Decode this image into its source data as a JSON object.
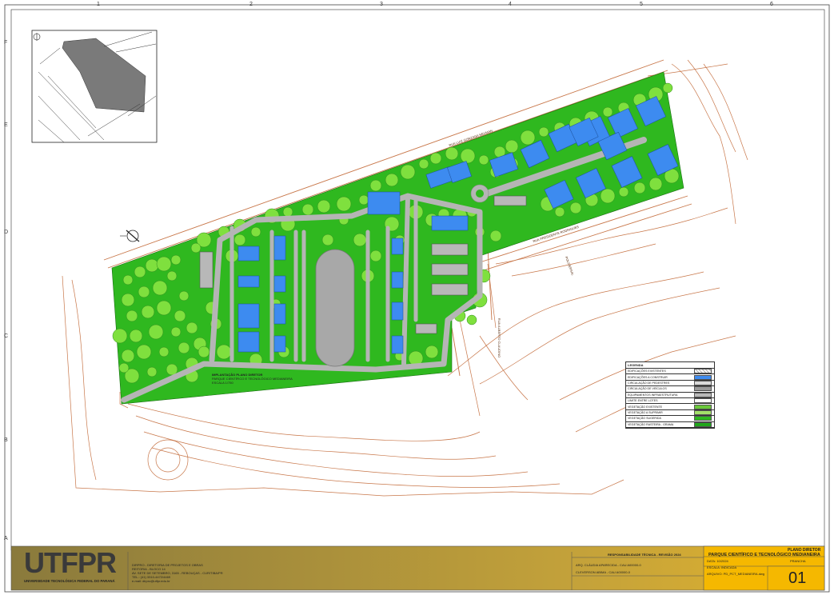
{
  "grid": {
    "columns": [
      "1",
      "2",
      "3",
      "4",
      "5",
      "6"
    ],
    "rows": [
      "F",
      "E",
      "D",
      "C",
      "B",
      "A"
    ]
  },
  "title_block": {
    "logo": "UTFPR",
    "logo_caption": "UNIVERSIDADE TECNOLÓGICA FEDERAL DO PARANÁ",
    "office_lines": [
      "DIRPRO - DIRETORIA DE PROJETOS E OBRAS",
      "REITORIA - BLOCO 14",
      "AV. SETE DE SETEMBRO, 3165 - REBOUÇAS - CURITIBA/PR",
      "TEL.: (41) 3310-4472/4469",
      "e-mail: dirpro@utfpr.edu.br"
    ],
    "responsibility": "RESPONSABILIDADE TÉCNICA - REVISÃO 2024",
    "resp_lines": [
      "ARQ. CLÁUDIA APARECIDA - CAU A00000-0",
      "CLEVERSON ABIMA - CAU A00000-0"
    ],
    "plan_title": "PLANO DIRETOR",
    "project_name": "PARQUE CIENTÍFICO E TECNOLÓGICO MEDIANEIRA",
    "fields": [
      {
        "label": "DATA:",
        "value": "10/2024"
      },
      {
        "label": "ESCALA:",
        "value": "INDICADA"
      },
      {
        "label": "ARQUIVO:",
        "value": "PD_PCT_MEDIANEIRA.dwg"
      }
    ],
    "sheet_label": "PRANCHA",
    "sheet_number": "01"
  },
  "plan_caption": [
    "IMPLANTAÇÃO PLANO DIRETOR",
    "PARQUE CIENTÍFICO E TECNOLÓGICO MEDIANEIRA",
    "ESCALA 1/750"
  ],
  "legend": {
    "title": "LEGENDA",
    "items": [
      {
        "label": "EDIFICAÇÕES EXISTENTES",
        "swatch": "#ffffff",
        "pattern": "hatch"
      },
      {
        "label": "EDIFICAÇÕES A CONSTRUIR",
        "swatch": "#3d8bf0",
        "pattern": "solid"
      },
      {
        "label": "CIRCULAÇÃO DE PEDESTRES",
        "swatch": "#d9d9d9",
        "pattern": "solid"
      },
      {
        "label": "CIRCULAÇÃO DE VEÍCULOS",
        "swatch": "#9a9a9a",
        "pattern": "dots"
      },
      {
        "label": "EQUIPAMENTOS INFRAESTRUTURA",
        "swatch": "#b8b8b8",
        "pattern": "solid"
      },
      {
        "label": "LIMITE ENTRE LOTES",
        "swatch": "#ffffff",
        "pattern": "line"
      },
      {
        "label": "VEGETAÇÃO EXISTENTE",
        "swatch": "#6ac93a",
        "pattern": "tree"
      },
      {
        "label": "VEGETAÇÃO A SUPRIMIR",
        "swatch": "#a3e06a",
        "pattern": "tree"
      },
      {
        "label": "VEGETAÇÃO SUGERIDA",
        "swatch": "#2fb81f",
        "pattern": "tree"
      },
      {
        "label": "VEGETAÇÃO RASTEIRA - GRAMA",
        "swatch": "#1fa51a",
        "pattern": "grass"
      }
    ]
  },
  "map_labels": {
    "road_north": "RUA LUIZ GONZAGA NEUMAN",
    "road_south": "RUA PRESIDENTE RODRIGUES",
    "street_east": "RUA ALBERTO CLAUDINO",
    "area_label": "POLIVERSAL"
  },
  "colors": {
    "grass": "#2fb81f",
    "tree": "#7fe03e",
    "tree_stroke": "#2c8a1c",
    "building_new": "#3d8bf0",
    "road": "#b5b5b5",
    "contour": "#c8774a",
    "titlebar": "#b99a3a",
    "titlebar_yellow": "#f5b800"
  }
}
